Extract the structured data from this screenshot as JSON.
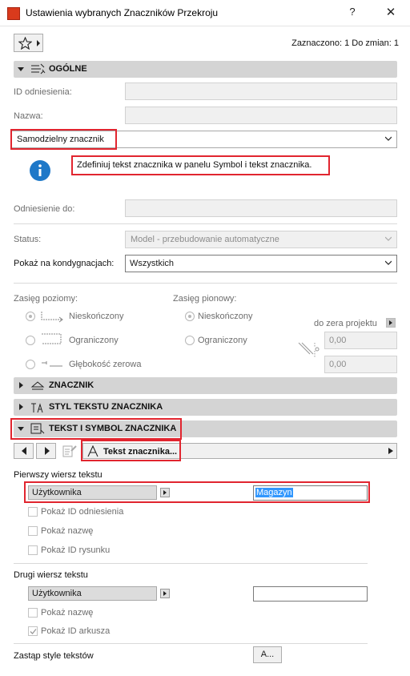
{
  "window": {
    "title": "Ustawienia wybranych Znaczników Przekroju",
    "help": "?",
    "close": "✕"
  },
  "header": {
    "selected_info": "Zaznaczono: 1 Do zmian: 1"
  },
  "sections": {
    "general": "OGÓLNE",
    "marker": "ZNACZNIK",
    "marker_text_style": "STYL TEKSTU ZNACZNIKA",
    "text_symbol": "TEKST I SYMBOL ZNACZNIKA"
  },
  "general": {
    "ref_id_label": "ID odniesienia:",
    "ref_id_value": "",
    "name_label": "Nazwa:",
    "name_value": "",
    "marker_type": "Samodzielny znacznik",
    "info_message": "Zdefiniuj tekst znacznika w panelu Symbol i tekst znacznika.",
    "reference_to_label": "Odniesienie do:",
    "reference_to_value": "",
    "status_label": "Status:",
    "status_value": "Model - przebudowanie automatyczne",
    "show_on_stories_label": "Pokaż na kondygnacjach:",
    "show_on_stories_value": "Wszystkich"
  },
  "range": {
    "horizontal_label": "Zasięg poziomy:",
    "horizontal_options": [
      "Nieskończony",
      "Ograniczony",
      "Głębokość zerowa"
    ],
    "vertical_label": "Zasięg pionowy:",
    "vertical_options": [
      "Nieskończony",
      "Ograniczony"
    ],
    "to_project_zero": "do zera projektu",
    "value_top": "0,00",
    "value_bottom": "0,00"
  },
  "text_symbol": {
    "marker_text_button": "Tekst znacznika...",
    "first_line_label": "Pierwszy wiersz tekstu",
    "first_line_source": "Użytkownika",
    "first_line_value": "Magazyn",
    "show_ref_id": "Pokaż ID odniesienia",
    "show_name_1": "Pokaż nazwę",
    "show_drawing_id": "Pokaż ID rysunku",
    "second_line_label": "Drugi wiersz tekstu",
    "second_line_source": "Użytkownika",
    "second_line_value": "",
    "show_name_2": "Pokaż nazwę",
    "show_sheet_id": "Pokaż ID arkusza",
    "override_styles_label": "Zastąp style tekstów",
    "override_btn": "A..."
  },
  "colors": {
    "highlight": "#e1252f",
    "info_icon": "#1e78c8",
    "section_bg": "#d4d4d4",
    "selection_blue": "#3297fd"
  }
}
